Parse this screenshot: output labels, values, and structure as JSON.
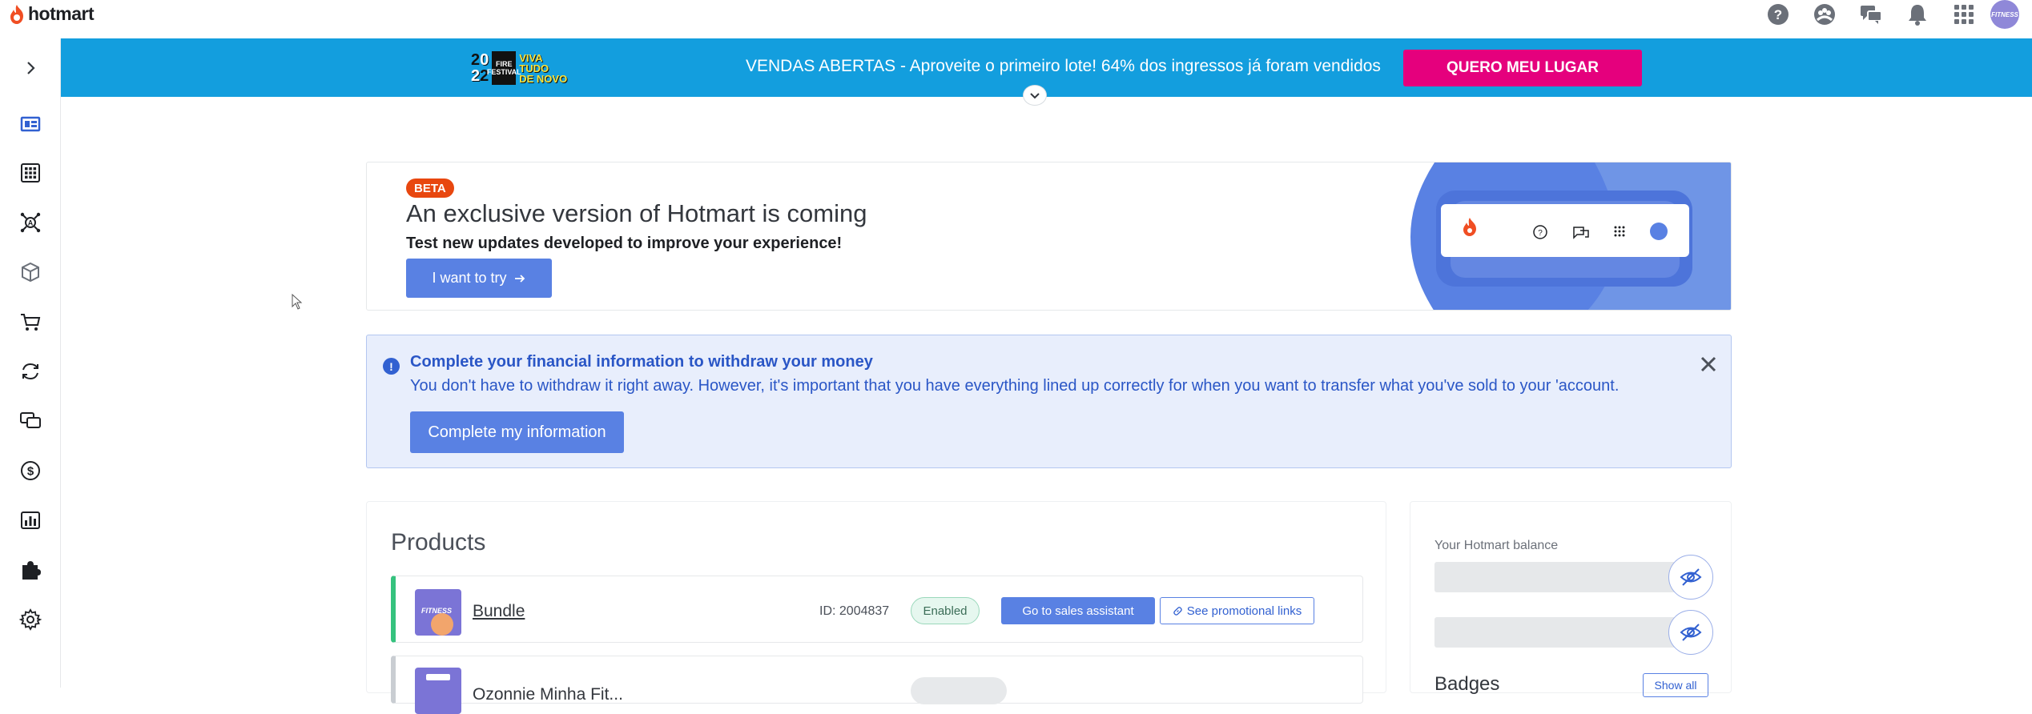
{
  "brand": {
    "name": "hotmart",
    "accent": "#f04e23"
  },
  "topbar": {
    "icons": [
      "help-icon",
      "community-icon",
      "chat-icon",
      "notifications-icon",
      "apps-grid-icon"
    ],
    "avatar_text": "FITNESS"
  },
  "sidebar": {
    "items": [
      {
        "name": "expand-icon"
      },
      {
        "name": "dashboard-icon"
      },
      {
        "name": "products-grid-icon"
      },
      {
        "name": "affiliates-network-icon"
      },
      {
        "name": "box-icon"
      },
      {
        "name": "cart-icon"
      },
      {
        "name": "recurrence-icon"
      },
      {
        "name": "messages-icon"
      },
      {
        "name": "finance-icon"
      },
      {
        "name": "analytics-icon"
      },
      {
        "name": "tools-puzzle-icon"
      },
      {
        "name": "settings-gear-icon"
      }
    ]
  },
  "banner": {
    "logo": {
      "year_digits": [
        "2",
        "0",
        "2",
        "2"
      ],
      "block_text": "FIRE FESTIVAL",
      "tag_lines": [
        "VIVA",
        "TUDO",
        "DE NOVO"
      ]
    },
    "text": "VENDAS ABERTAS - Aproveite o primeiro lote! 64% dos ingressos já foram vendidos",
    "button": "QUERO MEU LUGAR",
    "color": "#139ede",
    "button_color": "#e5007d"
  },
  "beta": {
    "badge": "BETA",
    "title": "An exclusive version of Hotmart is coming",
    "subtitle": "Test new updates developed to improve your experience!",
    "button": "I want to try"
  },
  "alert": {
    "icon": "!",
    "title": "Complete your financial information to withdraw your money",
    "text": "You don't have to withdraw it right away. However, it's important that you have everything lined up correctly for when you want to transfer what you've sold to your 'account.",
    "button": "Complete my information"
  },
  "products": {
    "title": "Products",
    "rows": [
      {
        "thumb_label": "FITNESS",
        "name": "Bundle",
        "id": "ID: 2004837",
        "status": "Enabled",
        "primary_action": "Go to sales assistant",
        "secondary_action": "See promotional links"
      },
      {
        "name": "Ozonnie Minha Fit..."
      }
    ]
  },
  "balance": {
    "label": "Your Hotmart balance",
    "badges_title": "Badges",
    "show_all": "Show all"
  }
}
